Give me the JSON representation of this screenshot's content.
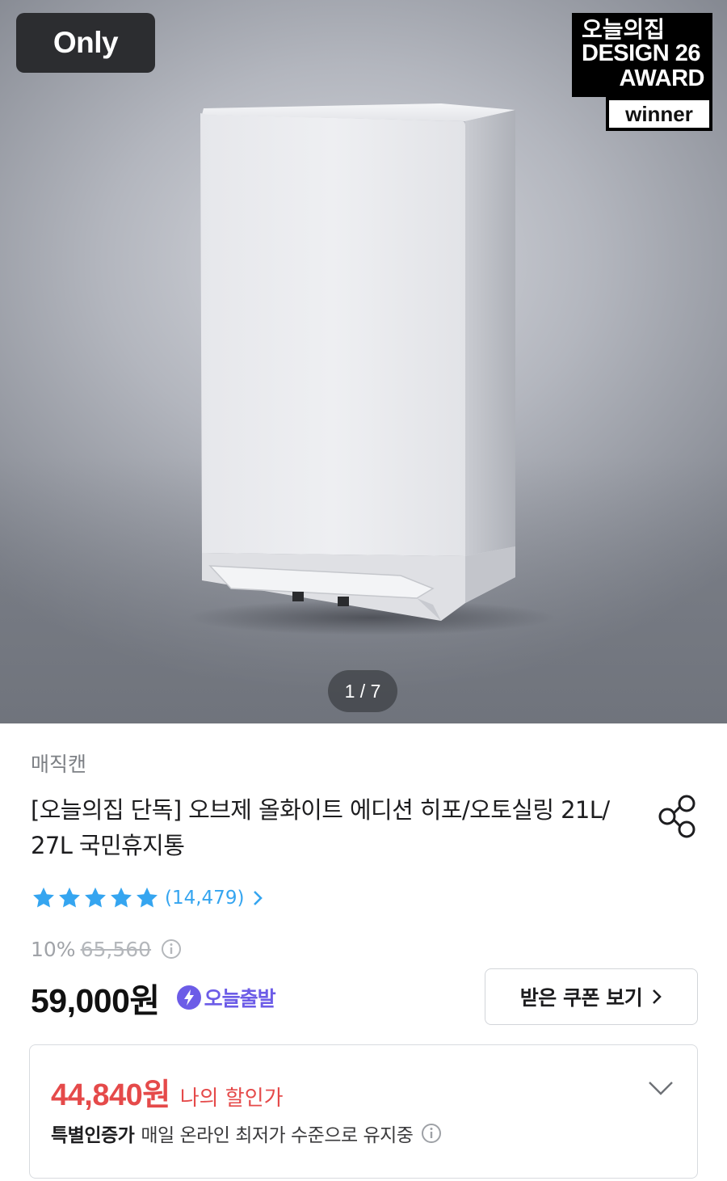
{
  "hero": {
    "only_badge": "Only",
    "award": {
      "line1": "오늘의집",
      "line2": "DESIGN 26",
      "line3": "AWARD",
      "winner": "winner"
    },
    "page_indicator": "1 / 7",
    "product_image": "white-trash-can"
  },
  "product": {
    "brand": "매직캔",
    "title": "[오늘의집 단독] 오브제 올화이트 에디션 히포/오토실링 21L/ 27L 국민휴지통",
    "rating": 5,
    "review_count": "(14,479)",
    "discount_rate": "10%",
    "original_price": "65,560",
    "price": "59,000원",
    "delivery_badge": "오늘출발",
    "coupon_button": "받은 쿠폰 보기",
    "my_price": "44,840원",
    "my_price_label": "나의 할인가",
    "special_label": "특별인증가",
    "special_text": "매일 온라인 최저가 수준으로 유지중"
  },
  "colors": {
    "accent_blue": "#35a5f0",
    "delivery_purple": "#6c5ce7",
    "sale_red": "#e54a4a"
  },
  "icons": [
    "share-icon",
    "star-icon",
    "chevron-right-icon",
    "info-icon",
    "bolt-icon",
    "chevron-down-icon"
  ]
}
